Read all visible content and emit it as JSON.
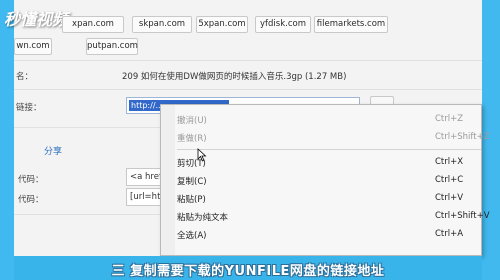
{
  "watermark": "秒懂视频",
  "domains": {
    "row1": [
      "xpan.com",
      "skpan.com",
      "5xpan.com",
      "yfdisk.com",
      "filemarkets.com"
    ],
    "row2": [
      "wn.com",
      "putpan.com"
    ]
  },
  "file": {
    "label": "名：",
    "value": "209 如何在使用DW做网页的时候插入音乐.3gp (1.27 MB)"
  },
  "link": {
    "label": "链接：",
    "selected_text": "http://..."
  },
  "share": {
    "title": "分享",
    "code_label": "代码：",
    "code_value": "<a href",
    "forum_label": "代码：",
    "forum_value": "[url=htt"
  },
  "context_menu": {
    "items": [
      {
        "label": "撤消(U)",
        "shortcut": "Ctrl+Z",
        "enabled": false
      },
      {
        "label": "重做(R)",
        "shortcut": "Ctrl+Shift+Z",
        "enabled": false
      },
      {
        "label": "剪切(T)",
        "shortcut": "Ctrl+X",
        "enabled": true
      },
      {
        "label": "复制(C)",
        "shortcut": "Ctrl+C",
        "enabled": true
      },
      {
        "label": "粘贴(P)",
        "shortcut": "Ctrl+V",
        "enabled": true
      },
      {
        "label": "粘贴为纯文本",
        "shortcut": "Ctrl+Shift+V",
        "enabled": true
      },
      {
        "label": "全选(A)",
        "shortcut": "Ctrl+A",
        "enabled": true
      }
    ]
  },
  "subtitle": "三 复制需要下载的YUNFILE网盘的链接地址"
}
